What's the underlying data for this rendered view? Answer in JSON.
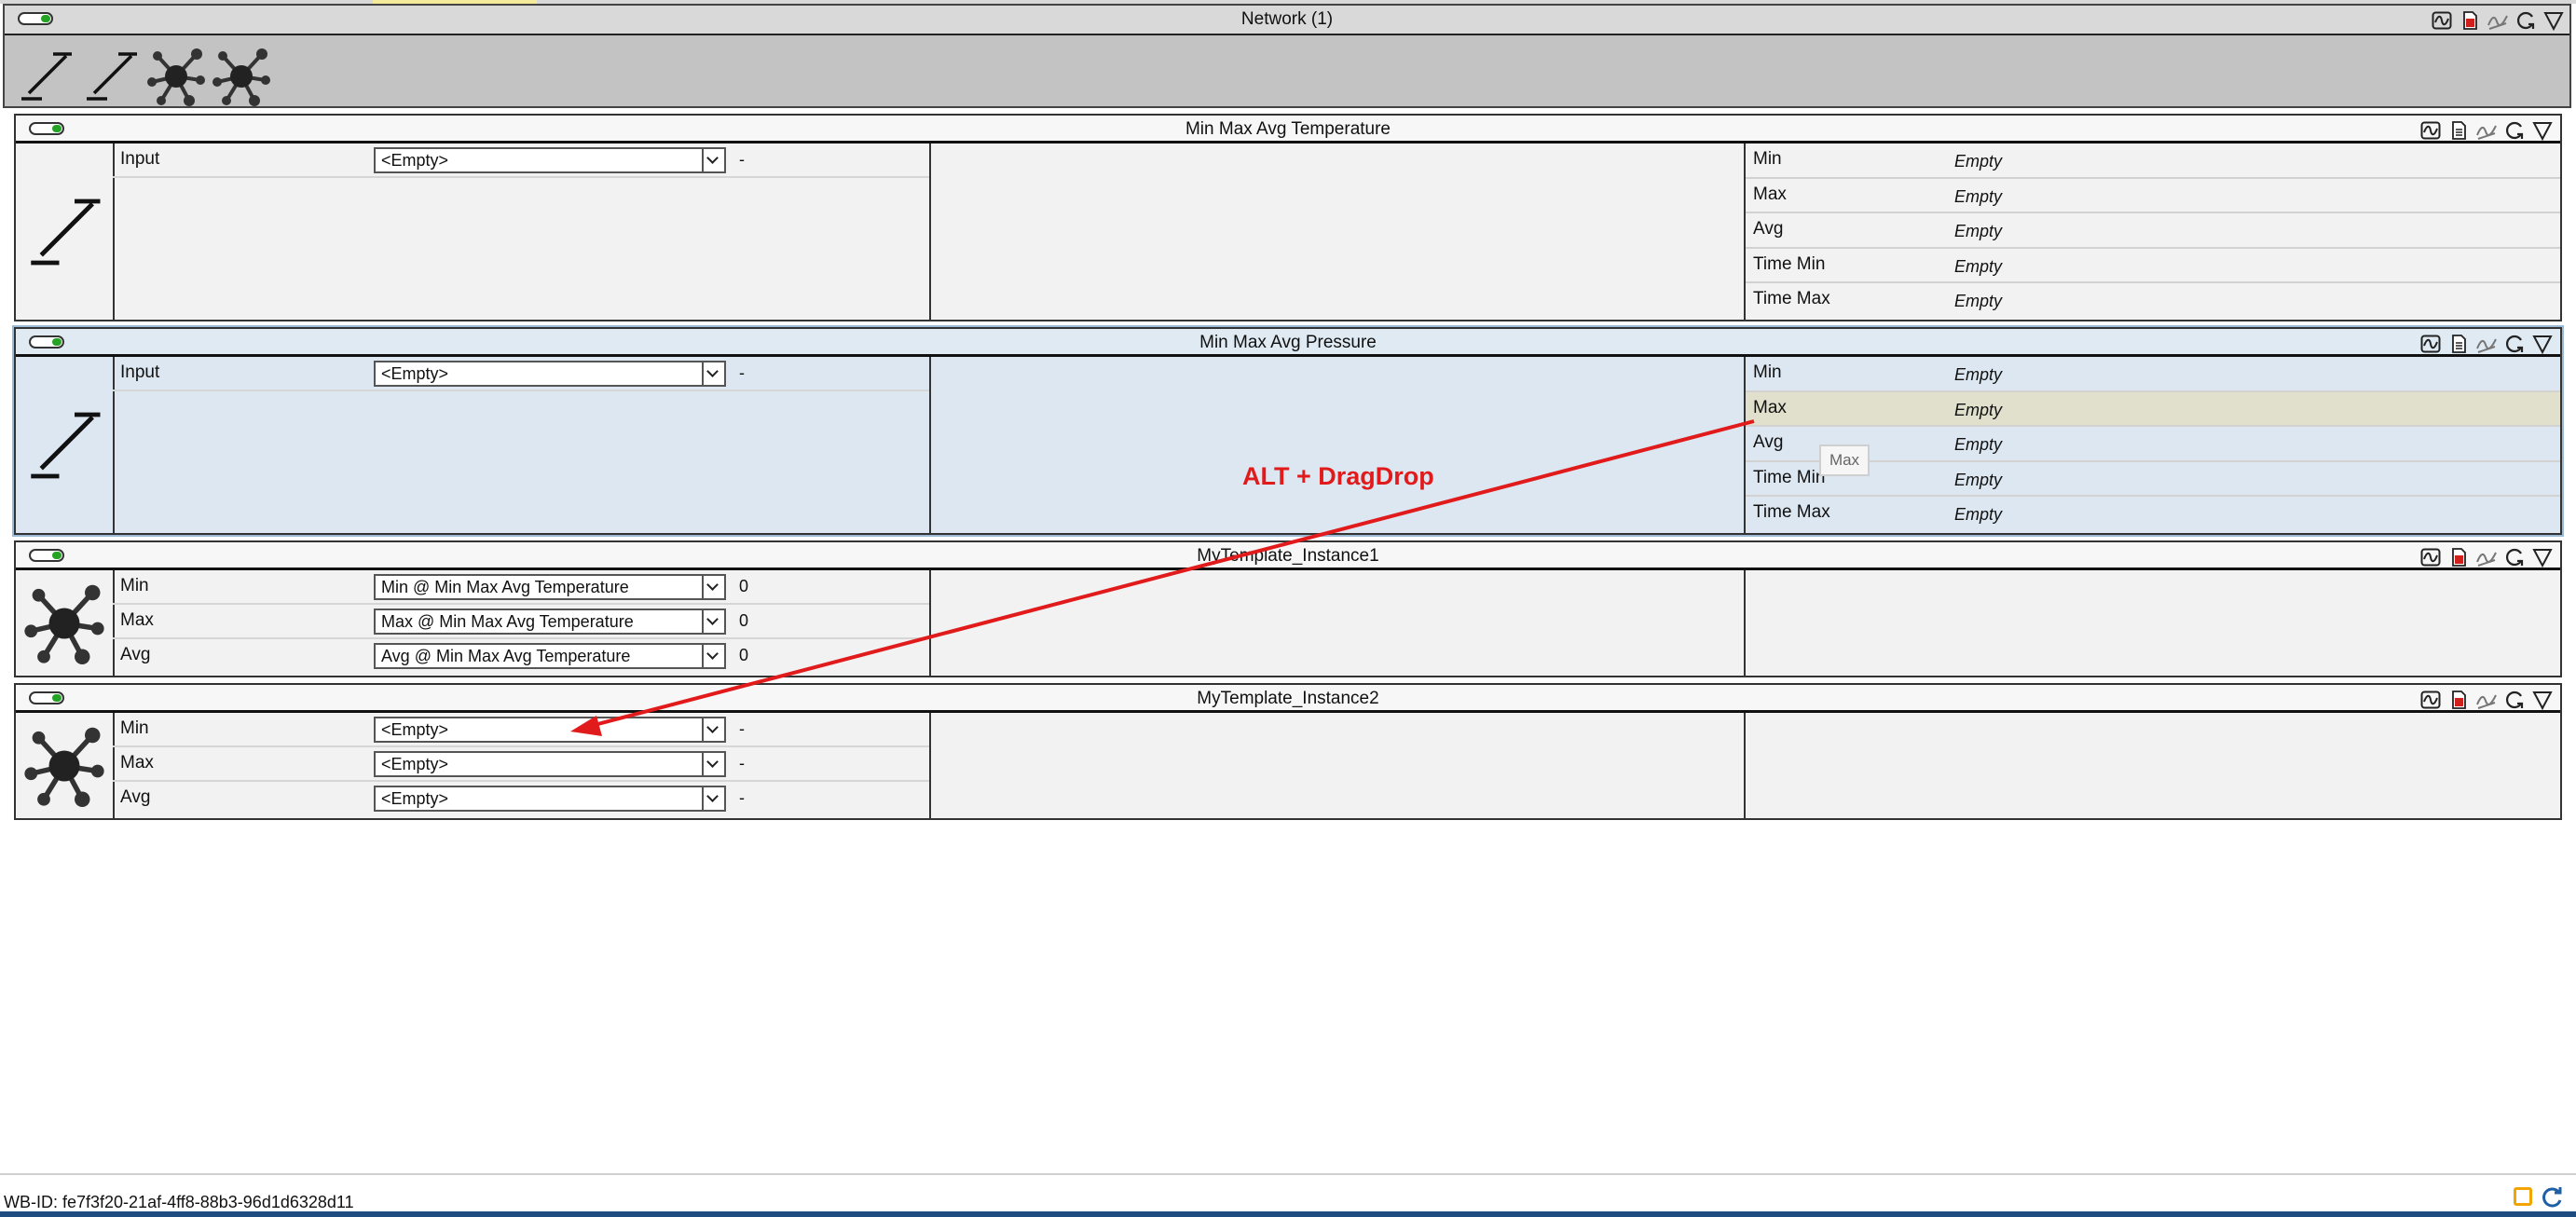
{
  "network": {
    "title": "Network (1)",
    "toolbar_icons": [
      "minmax-icon",
      "minmax-icon",
      "network-node-icon",
      "network-node-icon"
    ]
  },
  "header_icons": [
    "chart-icon",
    "document-icon",
    "signal-icon",
    "reload-icon",
    "filter-icon"
  ],
  "modules": [
    {
      "title": "Min Max Avg Temperature",
      "icon": "minmax-icon",
      "inputs": [
        {
          "label": "Input",
          "selected": "<Empty>",
          "value": "-"
        }
      ],
      "outputs": [
        {
          "label": "Min",
          "value": "Empty"
        },
        {
          "label": "Max",
          "value": "Empty"
        },
        {
          "label": "Avg",
          "value": "Empty"
        },
        {
          "label": "Time Min",
          "value": "Empty"
        },
        {
          "label": "Time Max",
          "value": "Empty"
        }
      ]
    },
    {
      "title": "Min Max Avg Pressure",
      "icon": "minmax-icon",
      "inputs": [
        {
          "label": "Input",
          "selected": "<Empty>",
          "value": "-"
        }
      ],
      "outputs": [
        {
          "label": "Min",
          "value": "Empty"
        },
        {
          "label": "Max",
          "value": "Empty"
        },
        {
          "label": "Avg",
          "value": "Empty"
        },
        {
          "label": "Time Min",
          "value": "Empty"
        },
        {
          "label": "Time Max",
          "value": "Empty"
        }
      ]
    },
    {
      "title": "MyTemplate_Instance1",
      "icon": "network-node-icon",
      "inputs": [
        {
          "label": "Min",
          "selected": "Min @ Min Max Avg Temperature",
          "value": "0"
        },
        {
          "label": "Max",
          "selected": "Max @ Min Max Avg Temperature",
          "value": "0"
        },
        {
          "label": "Avg",
          "selected": "Avg @ Min Max Avg Temperature",
          "value": "0"
        }
      ]
    },
    {
      "title": "MyTemplate_Instance2",
      "icon": "network-node-icon",
      "inputs": [
        {
          "label": "Min",
          "selected": "<Empty>",
          "value": "-"
        },
        {
          "label": "Max",
          "selected": "<Empty>",
          "value": "-"
        },
        {
          "label": "Avg",
          "selected": "<Empty>",
          "value": "-"
        }
      ]
    }
  ],
  "annotation": {
    "text": "ALT + DragDrop",
    "color": "#e11b1b"
  },
  "drag_tooltip": "Max",
  "status": {
    "wb_id": "WB-ID: fe7f3f20-21af-4ff8-88b3-96d1d6328d11"
  },
  "colors": {
    "accent_red": "#e11b1b",
    "toggle_green": "#25a325",
    "selected_module": "#dce7f1",
    "highlight_row": "#e1e0cc"
  }
}
